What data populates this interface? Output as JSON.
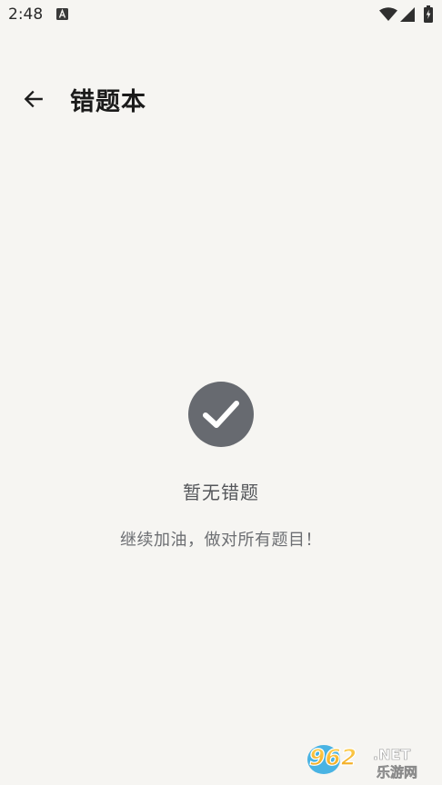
{
  "status_bar": {
    "time": "2:48"
  },
  "app_bar": {
    "title": "错题本"
  },
  "empty_state": {
    "title": "暂无错题",
    "subtitle": "继续加油，做对所有题目！"
  },
  "colors": {
    "background": "#f6f5f2",
    "icon_circle": "#676a70",
    "title_text": "#1b1b1b",
    "muted_text": "#55575b"
  },
  "watermark": {
    "text_top": "962.NET",
    "text_bottom": "乐游网"
  }
}
